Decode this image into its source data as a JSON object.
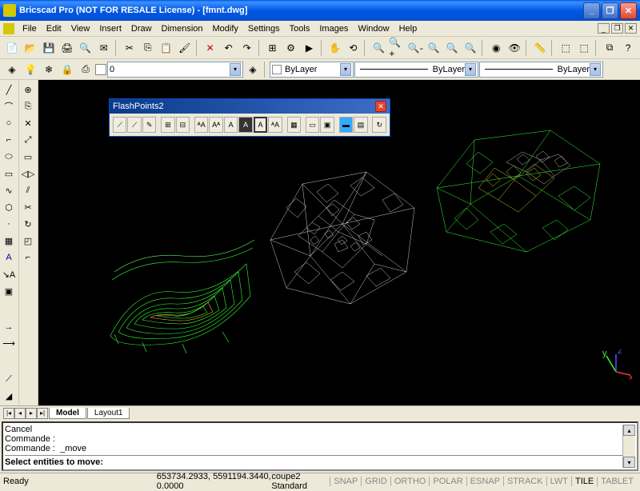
{
  "title": "Bricscad Pro (NOT FOR RESALE License) - [fmnt.dwg]",
  "menu": [
    "File",
    "Edit",
    "View",
    "Insert",
    "Draw",
    "Dimension",
    "Modify",
    "Settings",
    "Tools",
    "Images",
    "Window",
    "Help"
  ],
  "layer_props": {
    "current_layer": "0",
    "color": "ByLayer",
    "linetype": "ByLayer",
    "lineweight": "ByLayer"
  },
  "floating_window": {
    "title": "FlashPoints2"
  },
  "tabs": {
    "active": "Model",
    "items": [
      "Model",
      "Layout1"
    ]
  },
  "command": {
    "history": [
      "Cancel",
      "Commande :",
      "Commande :  _move"
    ],
    "prompt": "Select entities to move:"
  },
  "statusbar": {
    "ready": "Ready",
    "coords": "653734.2933, 5591194.3440, 0.0000",
    "style": "coupe2 Standard",
    "toggles": [
      "SNAP",
      "GRID",
      "ORTHO",
      "POLAR",
      "ESNAP",
      "STRACK",
      "LWT",
      "TILE",
      "TABLET"
    ],
    "toggles_active": [
      false,
      false,
      false,
      false,
      false,
      false,
      false,
      true,
      false
    ]
  },
  "ucs_labels": {
    "x": "x",
    "y": "y",
    "z": "z"
  }
}
